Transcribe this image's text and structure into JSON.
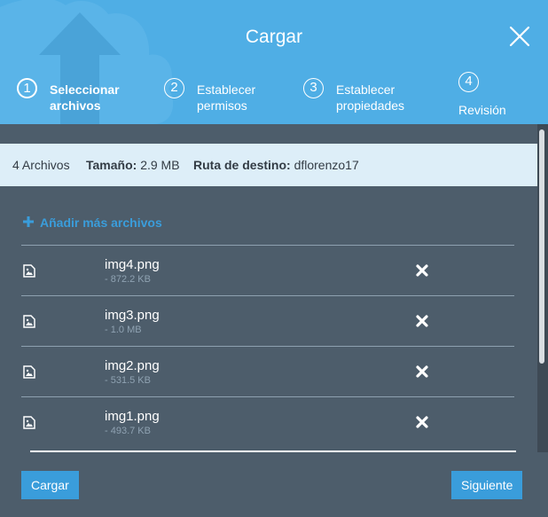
{
  "dialog": {
    "title": "Cargar",
    "close_icon": "close-icon"
  },
  "steps": [
    {
      "number": "1",
      "label": "Seleccionar\narchivos",
      "active": true
    },
    {
      "number": "2",
      "label": "Establecer\npermisos",
      "active": false
    },
    {
      "number": "3",
      "label": "Establecer\npropiedades",
      "active": false
    },
    {
      "number": "4",
      "label": "Revisión",
      "active": false
    }
  ],
  "info": {
    "count": "4 Archivos",
    "size_label": "Tamaño:",
    "size_value": "2.9 MB",
    "dest_label": "Ruta de destino:",
    "dest_value": "dflorenzo17"
  },
  "add_more": "Añadir más archivos",
  "files": [
    {
      "name": "img4.png",
      "size": "- 872.2 KB"
    },
    {
      "name": "img3.png",
      "size": "- 1.0 MB"
    },
    {
      "name": "img2.png",
      "size": "- 531.5 KB"
    },
    {
      "name": "img1.png",
      "size": "- 493.7 KB"
    }
  ],
  "footer": {
    "upload_label": "Cargar",
    "next_label": "Siguiente"
  },
  "colors": {
    "header": "#4faee5",
    "body": "#4d5d6b",
    "accent": "#3a9ddb",
    "infobar": "#ddeef8"
  }
}
